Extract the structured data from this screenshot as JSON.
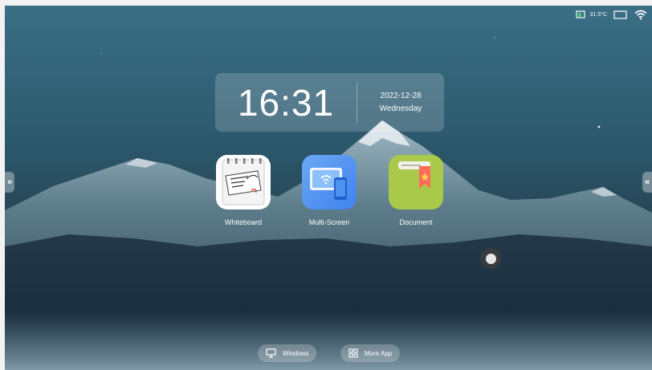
{
  "status": {
    "temperature": "31.5°C"
  },
  "clock": {
    "time": "16:31",
    "date": "2022-12-28",
    "weekday": "Wednesday"
  },
  "apps": [
    {
      "label": "Whiteboard",
      "icon": "whiteboard-icon"
    },
    {
      "label": "Multi-Screen",
      "icon": "multi-screen-icon"
    },
    {
      "label": "Document",
      "icon": "document-icon"
    }
  ],
  "side_tabs": {
    "left": "»",
    "right": "«"
  },
  "dock": {
    "windows_label": "Windows",
    "more_app_label": "More App"
  },
  "colors": {
    "multi_screen_bg": "#4a8df0",
    "document_bg": "#a9c94a",
    "document_bookmark": "#ff6b5b",
    "whiteboard_bg": "#ffffff"
  }
}
